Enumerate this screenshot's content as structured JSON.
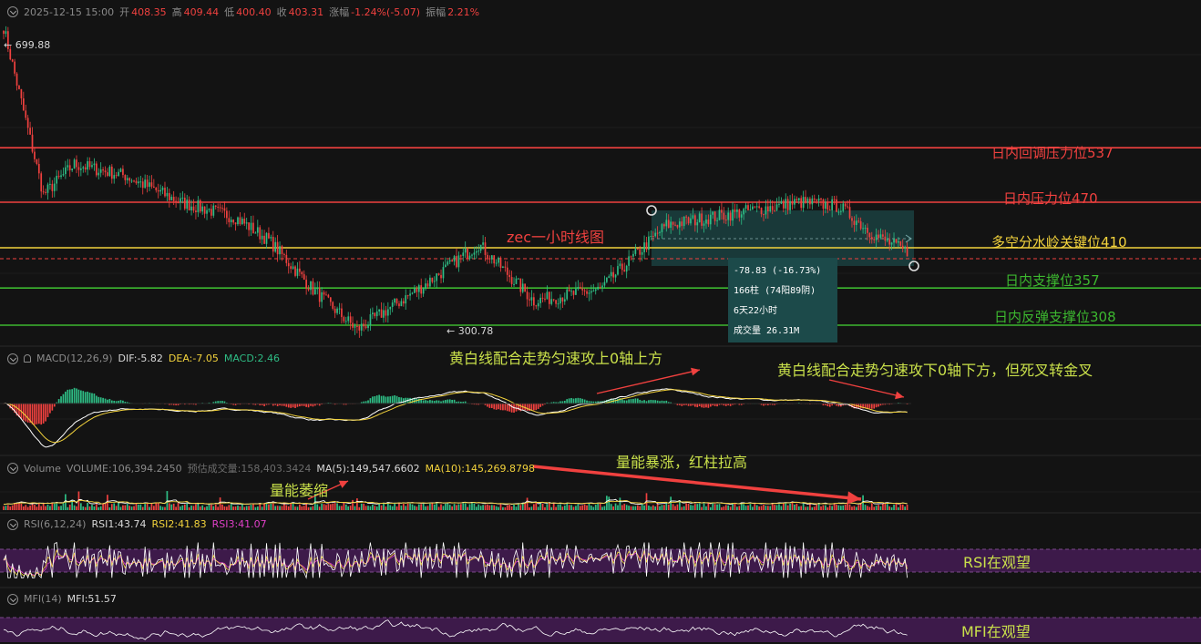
{
  "header": {
    "date": "2025-12-15 15:00",
    "open_label": "开",
    "open": "408.35",
    "high_label": "高",
    "high": "409.44",
    "low_label": "低",
    "low": "400.40",
    "close_label": "收",
    "close": "403.31",
    "change_label": "涨幅",
    "change": "-1.24%(-5.07)",
    "amp_label": "振幅",
    "amp": "2.21%"
  },
  "price": {
    "high_mark": "← 699.88",
    "low_mark": "← 300.78",
    "title_note": "zec一小时线图"
  },
  "levels": [
    {
      "label": "日内回调压力位537",
      "value": 537,
      "color": "#f0413f"
    },
    {
      "label": "日内压力位470",
      "value": 470,
      "color": "#f0413f"
    },
    {
      "label": "多空分水岭关键位410",
      "value": 410,
      "color": "#f3d33c"
    },
    {
      "label": "日内支撑位357",
      "value": 357,
      "color": "#3cb72f"
    },
    {
      "label": "日内反弹支撑位308",
      "value": 308,
      "color": "#3cb72f"
    }
  ],
  "measure": {
    "change": "-78.83 (-16.73%)",
    "bars": "166柱 (74阳89阴)",
    "duration": "6天22小时",
    "volume": "成交量 26.31M"
  },
  "macd": {
    "name": "MACD(12,26,9)",
    "dif": "DIF:-5.82",
    "dea": "DEA:-7.05",
    "macd": "MACD:2.46",
    "note1": "黄白线配合走势匀速攻上0轴上方",
    "note2": "黄白线配合走势匀速攻下0轴下方，但死叉转金叉"
  },
  "volume": {
    "name": "Volume",
    "vol": "VOLUME:106,394.2450",
    "est": "预估成交量:158,403.3424",
    "ma5": "MA(5):149,547.6602",
    "ma10": "MA(10):145,269.8798",
    "note1": "量能萎缩",
    "note2": "量能暴涨，红柱拉高"
  },
  "rsi": {
    "name": "RSI(6,12,24)",
    "rsi1": "RSI1:43.74",
    "rsi2": "RSI2:41.83",
    "rsi3": "RSI3:41.07",
    "note": "RSI在观望"
  },
  "mfi": {
    "name": "MFI(14)",
    "mfi": "MFI:51.57",
    "note": "MFI在观望"
  },
  "colors": {
    "up": "#2ebd85",
    "down": "#f0413f",
    "dif": "#ffffff",
    "dea": "#f3d33c",
    "band": "#3d1a4a"
  },
  "chart_data": {
    "type": "candlestick",
    "timeframe": "1h",
    "ylim": [
      290,
      710
    ],
    "annotated_high": 699.88,
    "annotated_low": 300.78,
    "trend_keypoints": [
      {
        "bar": 0,
        "price": 700
      },
      {
        "bar": 18,
        "price": 480
      },
      {
        "bar": 32,
        "price": 520
      },
      {
        "bar": 55,
        "price": 505
      },
      {
        "bar": 80,
        "price": 470
      },
      {
        "bar": 105,
        "price": 450
      },
      {
        "bar": 120,
        "price": 420
      },
      {
        "bar": 140,
        "price": 355
      },
      {
        "bar": 160,
        "price": 302
      },
      {
        "bar": 190,
        "price": 360
      },
      {
        "bar": 215,
        "price": 415
      },
      {
        "bar": 240,
        "price": 340
      },
      {
        "bar": 270,
        "price": 355
      },
      {
        "bar": 300,
        "price": 440
      },
      {
        "bar": 330,
        "price": 455
      },
      {
        "bar": 360,
        "price": 470
      },
      {
        "bar": 378,
        "price": 465
      },
      {
        "bar": 395,
        "price": 425
      },
      {
        "bar": 410,
        "price": 403
      }
    ],
    "rsi_band": [
      30,
      70
    ],
    "mfi_band": [
      20,
      80
    ]
  }
}
